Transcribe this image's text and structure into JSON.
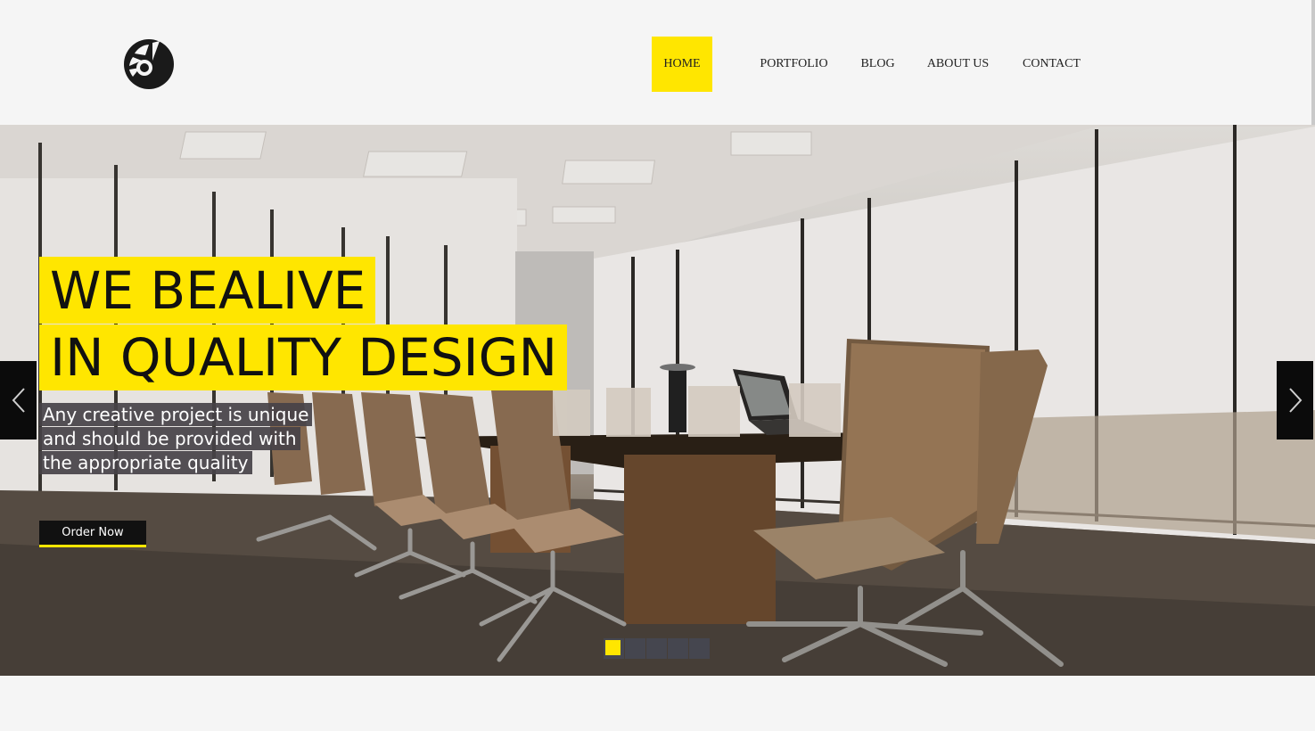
{
  "header": {
    "logo_icon": "abstract-circle-logo",
    "nav": [
      {
        "label": "HOME",
        "active": true
      },
      {
        "label": "PORTFOLIO",
        "active": false
      },
      {
        "label": "BLOG",
        "active": false
      },
      {
        "label": "ABOUT US",
        "active": false
      },
      {
        "label": "CONTACT",
        "active": false
      }
    ]
  },
  "hero": {
    "headline": [
      "WE BEALIVE",
      "IN QUALITY DESIGN"
    ],
    "subtext": [
      "Any creative project is unique",
      "and should be provided with",
      "the appropriate quality"
    ],
    "cta_label": "Order Now",
    "prev_icon": "chevron-left-icon",
    "next_icon": "chevron-right-icon",
    "slides_total": 5,
    "active_slide": 1
  },
  "colors": {
    "accent": "#ffe600",
    "dark": "#111111",
    "page_bg": "#f5f5f5"
  }
}
